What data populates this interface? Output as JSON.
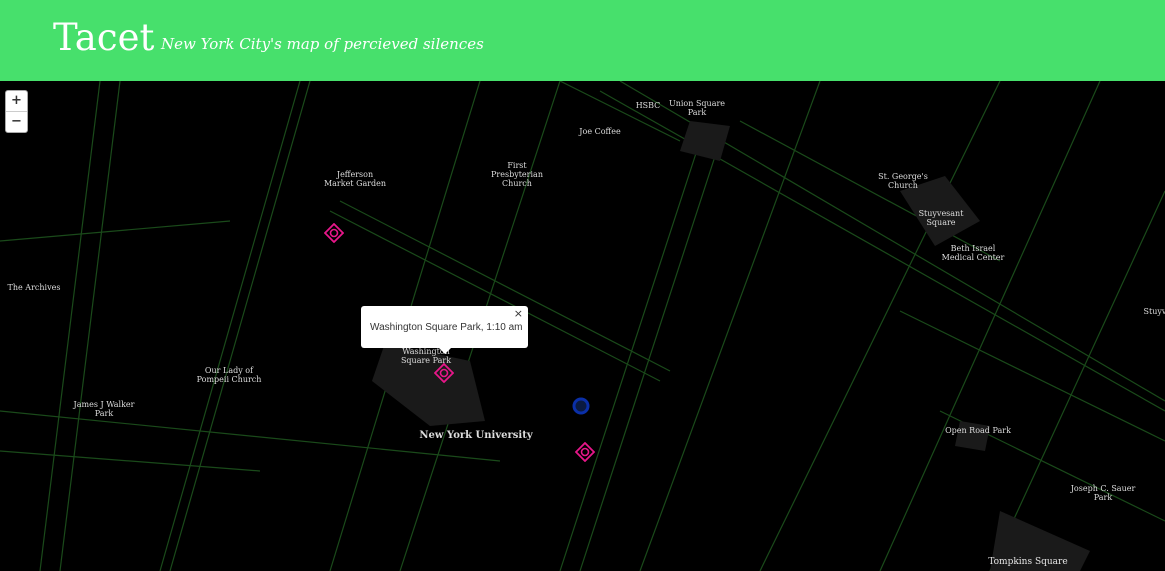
{
  "header": {
    "title": "Tacet",
    "subtitle": "New York City's map of percieved silences"
  },
  "zoom": {
    "in": "+",
    "out": "−"
  },
  "colors": {
    "header": "#47e06c",
    "marker": "#e8178a",
    "location": "#0a2fa8",
    "street": "#1f5a1f"
  },
  "labels": {
    "hsbc": "HSBC",
    "union_square": "Union Square\nPark",
    "joe_coffee": "Joe Coffee",
    "jefferson": "Jefferson\nMarket Garden",
    "first_presb": "First\nPresbyterian\nChurch",
    "st_george": "St. George's\nChurch",
    "stuyvesant": "Stuyvesant\nSquare",
    "beth_israel": "Beth Israel\nMedical Center",
    "archives": "The Archives",
    "stuyv_edge": "Stuyv",
    "wsp": "Washington\nSquare Park",
    "our_lady": "Our Lady of\nPompeii Church",
    "james_walker": "James J Walker\nPark",
    "nyu": "New York University",
    "open_road": "Open Road Park",
    "joseph_sauer": "Joseph C. Sauer\nPark",
    "tompkins": "Tompkins Square"
  },
  "popup": {
    "text": "Washington Square Park, 1:10 am",
    "close": "×"
  }
}
